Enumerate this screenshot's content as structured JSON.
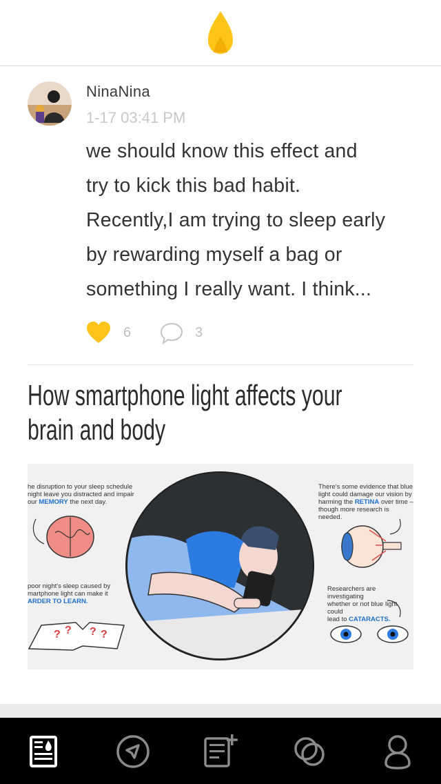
{
  "header": {
    "logo_icon": "flame-logo-icon",
    "accent": "#fcc419"
  },
  "post": {
    "user": "NinaNina",
    "time": "1-17 03:41 PM",
    "lines": [
      "we should know this effect and",
      "try to kick this bad habit.",
      "Recently,I am trying to sleep early",
      "by rewarding myself a bag or",
      "something I really want. I think..."
    ],
    "likes": "6",
    "comments": "3"
  },
  "article": {
    "title_line1": "How smartphone light affects your",
    "title_line2": "brain and body",
    "image": {
      "cap_memory_1": "he disruption to your sleep schedule",
      "cap_memory_2": "night leave you distracted and impair",
      "cap_memory_3a": "our ",
      "cap_memory_3b": "MEMORY",
      "cap_memory_3c": " the next day.",
      "cap_learn_1": "poor night's sleep caused by",
      "cap_learn_2": "martphone light can make it",
      "cap_learn_3": "ARDER TO LEARN.",
      "cap_retina_1": "There's some evidence that blue",
      "cap_retina_2": "light could damage our vision by",
      "cap_retina_3a": "harming the ",
      "cap_retina_3b": "RETINA",
      "cap_retina_3c": " over time –",
      "cap_retina_4": "though more research is needed.",
      "cap_cataract_1": "Researchers are investigating",
      "cap_cataract_2": "whether or not blue light could",
      "cap_cataract_3a": "lead to ",
      "cap_cataract_3b": "CATARACTS."
    }
  },
  "tabbar": {
    "tabs": [
      {
        "name": "feed-icon"
      },
      {
        "name": "compass-icon"
      },
      {
        "name": "new-post-icon"
      },
      {
        "name": "circles-icon"
      },
      {
        "name": "profile-icon"
      }
    ]
  }
}
